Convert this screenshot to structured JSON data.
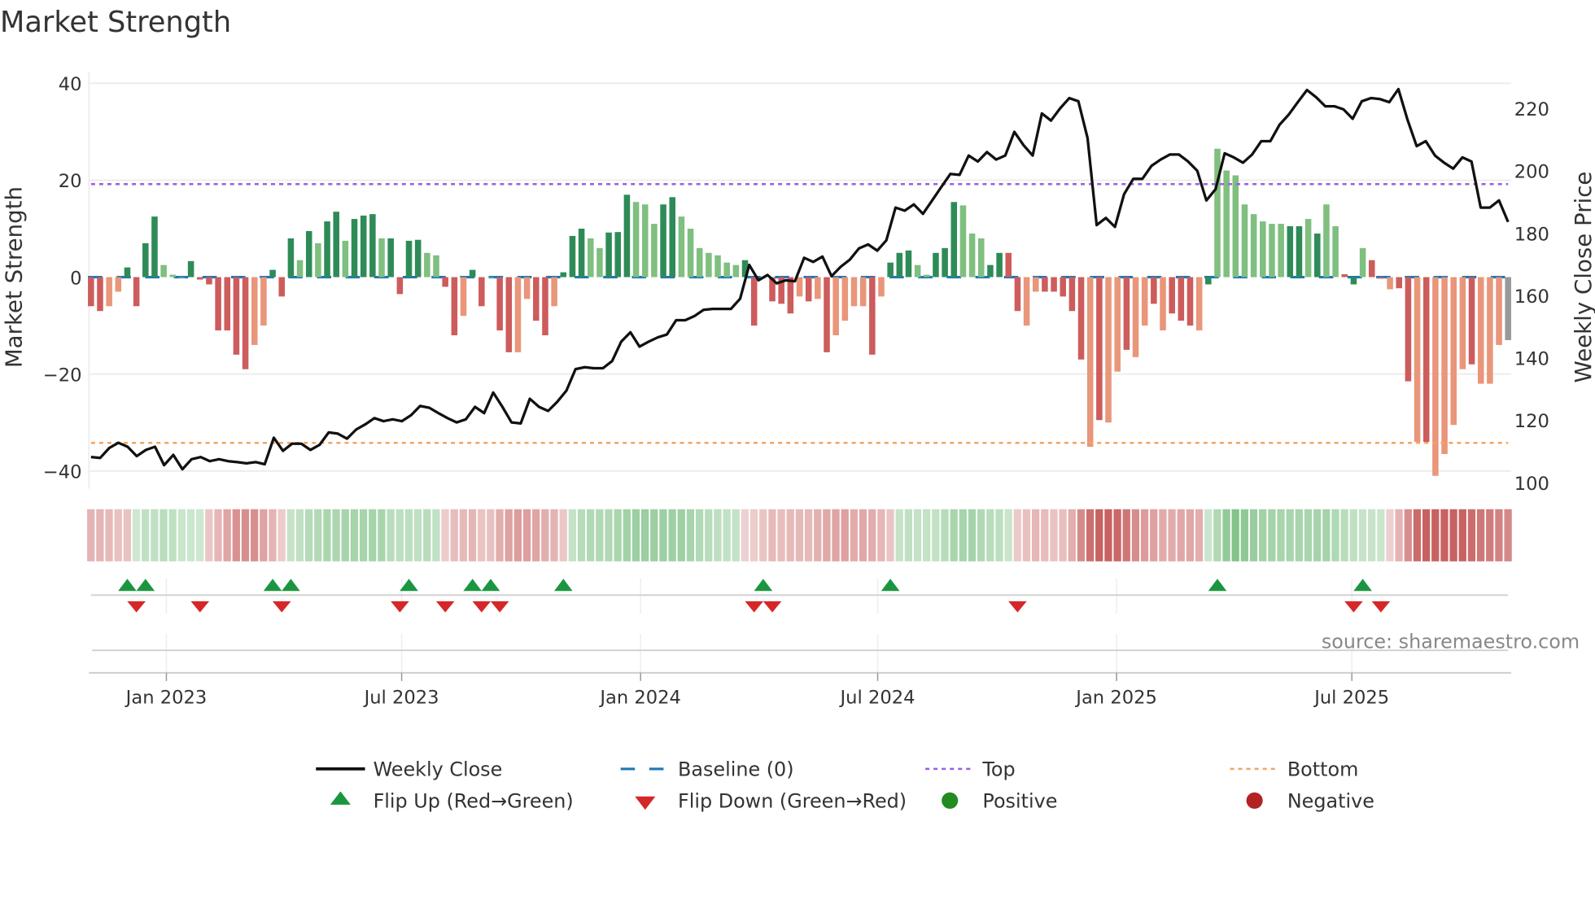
{
  "chart_data": {
    "type": "bar",
    "title": "Market Strength",
    "ylabel": "Market Strength",
    "y2label": "Weekly Close Price",
    "ylim": [
      -44,
      44
    ],
    "y2lim": [
      95,
      230
    ],
    "yticks": [
      "40",
      "20",
      "0",
      "−20",
      "−40"
    ],
    "ytick_values": [
      40,
      20,
      0,
      -20,
      -40
    ],
    "y2ticks": [
      "220",
      "200",
      "180",
      "160",
      "140",
      "120",
      "100"
    ],
    "y2tick_values": [
      220,
      200,
      180,
      160,
      140,
      120,
      100
    ],
    "xticks": [
      {
        "label": "Jan 2023",
        "week": 8.3
      },
      {
        "label": "Jul 2023",
        "week": 34.2
      },
      {
        "label": "Jan 2024",
        "week": 60.5
      },
      {
        "label": "Jul 2024",
        "week": 86.6
      },
      {
        "label": "Jan 2025",
        "week": 112.9
      },
      {
        "label": "Jul 2025",
        "week": 138.8
      }
    ],
    "top_threshold": 19.2,
    "bottom_threshold": -34.2,
    "baseline": 0,
    "strength": [
      -6,
      -7,
      -6,
      -3,
      2,
      -6,
      7,
      12.5,
      2.5,
      0.5,
      0,
      3.3,
      -0.5,
      -1.5,
      -11,
      -11,
      -16,
      -19,
      -14,
      -10,
      1.5,
      -4,
      8,
      3.5,
      9.5,
      7,
      11.5,
      13.5,
      7.5,
      12,
      12.7,
      13,
      8,
      8,
      -3.5,
      7.5,
      7.7,
      5,
      4.5,
      -2,
      -12,
      -8,
      1.5,
      -6,
      0,
      -11,
      -15.5,
      -15.5,
      -4.5,
      -9,
      -12,
      -6,
      1,
      8.5,
      10,
      8,
      6,
      9.2,
      9.3,
      17,
      15.5,
      15,
      11,
      15,
      16.5,
      12.5,
      10,
      6,
      5,
      4.5,
      3,
      2.5,
      3.5,
      -10,
      0,
      -5,
      -5.5,
      -7.5,
      -4,
      -5,
      -4.5,
      -15.5,
      -12,
      -9,
      -6,
      -6,
      -16,
      -4,
      3,
      5,
      5.5,
      2.5,
      0.5,
      5,
      6,
      15.5,
      14.8,
      9,
      8,
      2.5,
      5,
      5,
      -7,
      -10,
      -3,
      -3,
      -3,
      -4,
      -7,
      -17,
      -35,
      -29.5,
      -30,
      -19.5,
      -15,
      -16.5,
      -10,
      -5.5,
      -11,
      -7.5,
      -9,
      -10,
      -11,
      -1.5,
      26.5,
      22,
      21,
      15,
      13,
      11.5,
      11,
      11,
      10.5,
      10.5,
      12,
      9,
      15,
      10.5,
      0.6,
      -1.5,
      6,
      3.5,
      -0.3,
      -2.5,
      -2.3,
      -21.5,
      -34,
      -34,
      -41,
      -36.5,
      -30.5,
      -19,
      -18,
      -22,
      -22,
      -14,
      -13
    ],
    "shade": "RRSSGRGGLLLGRRRRRRSSGRGLGLGGLGGGLGRGGLLRRSGRLRRSSRRSGGGLLGGGLLLGGLLLLLLLGRLRRRSRSRSSSSRSGGGLLGGGLLLGGRRSSRRRRRSRSSRSSRSRRRSGLLLLLLLLGGLGLLRGLRRSRRSRSSSSRSSS",
    "weekly_close": [
      108.2,
      107.9,
      111.1,
      112.8,
      111.5,
      108.5,
      110.5,
      111.5,
      105.6,
      108.9,
      104.3,
      107.5,
      108.2,
      106.9,
      107.5,
      106.9,
      106.6,
      106.2,
      106.6,
      105.9,
      114.4,
      110.2,
      112.5,
      112.5,
      110.5,
      112.1,
      116.1,
      115.7,
      114.1,
      117,
      118.7,
      120.7,
      119.7,
      120.3,
      119.7,
      121.6,
      124.6,
      124,
      122.3,
      120.7,
      119.3,
      120.3,
      124.3,
      122.3,
      128.9,
      124.3,
      119.3,
      119,
      126.9,
      124.3,
      123,
      125.9,
      129.5,
      136.4,
      137,
      136.7,
      136.7,
      139,
      145.2,
      148.2,
      143.6,
      145.2,
      146.6,
      147.5,
      152.1,
      152.1,
      153.4,
      155.4,
      155.7,
      155.7,
      155.7,
      159,
      169.8,
      164.9,
      166.6,
      163.9,
      164.9,
      164.6,
      172.1,
      170.8,
      172.5,
      166.2,
      169.2,
      171.5,
      175.1,
      176.4,
      174.4,
      177.7,
      188.2,
      187.2,
      189.2,
      186.2,
      190.5,
      194.8,
      199,
      198.7,
      204.9,
      203,
      206,
      203.6,
      204.9,
      212.5,
      208.2,
      204.9,
      218.4,
      216.1,
      220,
      223.3,
      222.3,
      210.5,
      182.6,
      184.9,
      182,
      192.5,
      197.4,
      197.4,
      201.6,
      203.6,
      205.2,
      205.2,
      203,
      200,
      190.5,
      194.1,
      205.6,
      204.3,
      202.6,
      205.2,
      209.5,
      209.5,
      214.8,
      218,
      222,
      225.9,
      223.6,
      220.7,
      220.7,
      219.7,
      216.7,
      222.3,
      223.3,
      223,
      222,
      226.2,
      216.4,
      207.9,
      209.5,
      204.9,
      202.6,
      200.7,
      204.3,
      203,
      188.2,
      188.2,
      190.5,
      183.6
    ],
    "flip_up_weeks": [
      4,
      6,
      20,
      22,
      35,
      42,
      44,
      52,
      74,
      88,
      124,
      140
    ],
    "flip_down_weeks": [
      5,
      12,
      21,
      34,
      39,
      43,
      45,
      73,
      75,
      102,
      139,
      142
    ],
    "legend": {
      "position": "bottom",
      "weekly_close": "Weekly Close",
      "baseline": "Baseline (0)",
      "top": "Top",
      "bottom": "Bottom",
      "flip_up": "Flip Up (Red→Green)",
      "flip_down": "Flip Down (Green→Red)",
      "positive": "Positive",
      "negative": "Negative"
    },
    "source": "source: sharemaestro.com"
  },
  "colors": {
    "G": "#2e8b57",
    "L": "#7fbf7f",
    "R": "#cd5c5c",
    "S": "#e9967a",
    "close": "#111111",
    "baseline": "#1f77b4",
    "top": "#9b5de5",
    "bottom": "#f4a460",
    "up": "#1a9641",
    "down": "#d62728",
    "positive": "#228b22",
    "negative": "#b22222"
  }
}
